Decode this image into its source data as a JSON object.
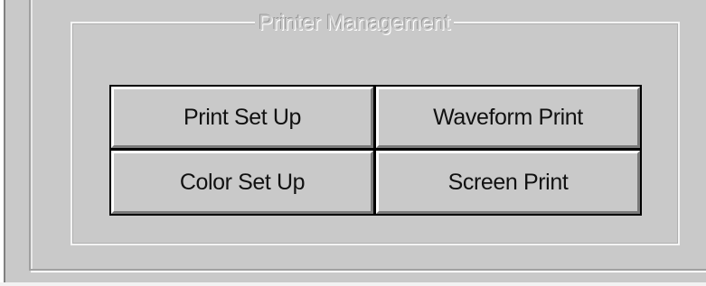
{
  "groupbox": {
    "title": "Printer Management"
  },
  "buttons": {
    "print_set_up": "Print Set Up",
    "waveform_print": "Waveform Print",
    "color_set_up": "Color Set Up",
    "screen_print": "Screen Print"
  },
  "colors": {
    "panel": "#c9c9c9",
    "highlight": "#ffffff",
    "shadow": "#7a7a7a",
    "text": "#111111"
  }
}
